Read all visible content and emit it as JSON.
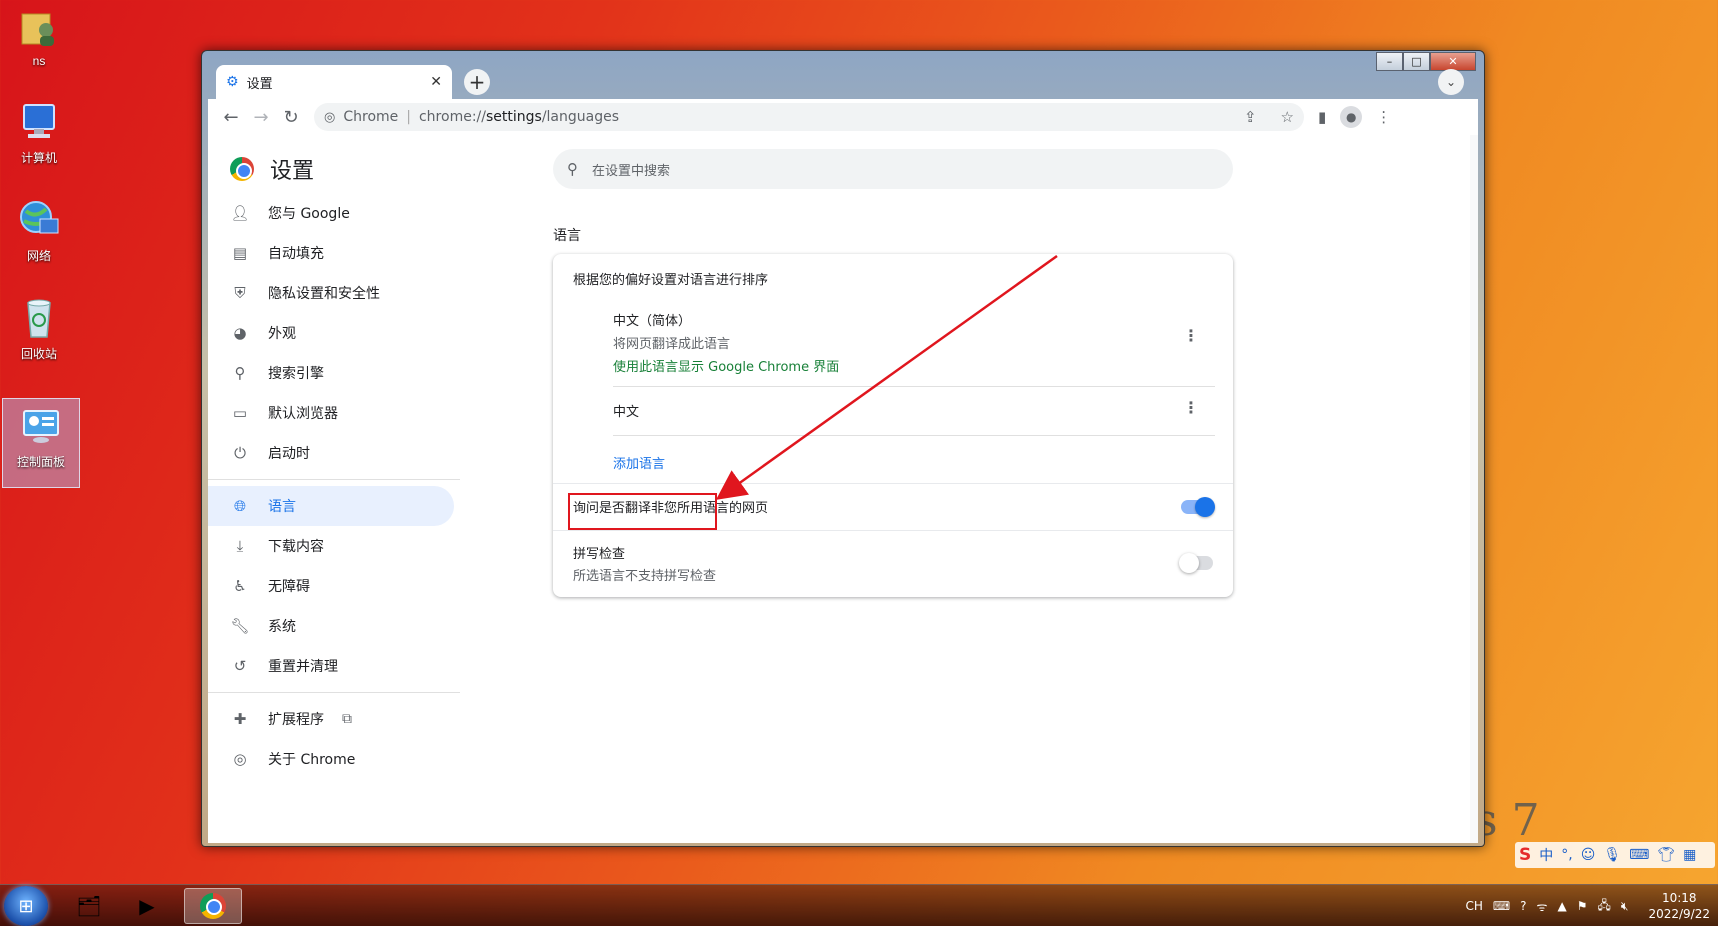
{
  "desktop": {
    "icons": [
      {
        "label": "ns"
      },
      {
        "label": "计算机"
      },
      {
        "label": "网络"
      },
      {
        "label": "回收站"
      },
      {
        "label": "控制面板"
      }
    ]
  },
  "window": {
    "tab": {
      "title": "设置"
    },
    "controls": {
      "minimize": "–",
      "maximize": "□",
      "close": "✕"
    }
  },
  "toolbar": {
    "site_label": "Chrome",
    "url_scheme": "chrome://",
    "url_host": "settings",
    "url_path": "/languages"
  },
  "sidebar": {
    "title": "设置",
    "items": [
      {
        "label": "您与 Google"
      },
      {
        "label": "自动填充"
      },
      {
        "label": "隐私设置和安全性"
      },
      {
        "label": "外观"
      },
      {
        "label": "搜索引擎"
      },
      {
        "label": "默认浏览器"
      },
      {
        "label": "启动时"
      },
      {
        "label": "语言"
      },
      {
        "label": "下载内容"
      },
      {
        "label": "无障碍"
      },
      {
        "label": "系统"
      },
      {
        "label": "重置并清理"
      },
      {
        "label": "扩展程序"
      },
      {
        "label": "关于 Chrome"
      }
    ]
  },
  "main": {
    "search_placeholder": "在设置中搜索",
    "section_title": "语言",
    "order_label": "根据您的偏好设置对语言进行排序",
    "languages": [
      {
        "name": "中文（简体）",
        "translate_note": "将网页翻译成此语言",
        "ui_note": "使用此语言显示 Google Chrome 界面"
      },
      {
        "name": "中文"
      }
    ],
    "add_language": "添加语言",
    "translate_offer": {
      "title": "询问是否翻译非您所用语言的网页",
      "enabled": true
    },
    "spell_check": {
      "title": "拼写检查",
      "subtitle": "所选语言不支持拼写检查",
      "enabled": false
    }
  },
  "ime": {
    "logo": "S",
    "mode": "中",
    "punct": "°,"
  },
  "taskbar": {
    "tray_lang": "CH",
    "time": "10:18",
    "date": "2022/9/22"
  },
  "deco": {
    "win7_text": "s 7"
  },
  "colors": {
    "accent": "#1a73e8",
    "annotation": "#e0161e",
    "green_text": "#188038"
  }
}
